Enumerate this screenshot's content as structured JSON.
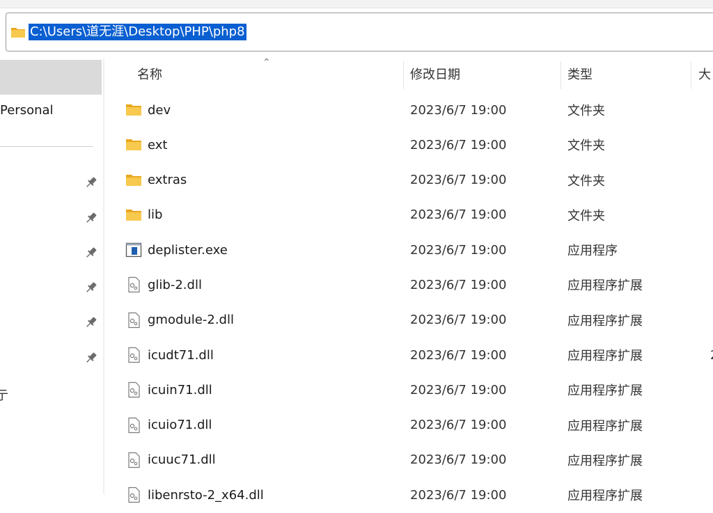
{
  "address": {
    "path": "C:\\Users\\道无涯\\Desktop\\PHP\\php8"
  },
  "nav": {
    "label": "Personal",
    "glyph": "亍",
    "pins": [
      "pin-icon",
      "pin-icon",
      "pin-icon",
      "pin-icon",
      "pin-icon",
      "pin-icon"
    ]
  },
  "columns": {
    "name": "名称",
    "date": "修改日期",
    "type": "类型",
    "size": "大"
  },
  "files": [
    {
      "name": "dev",
      "date": "2023/6/7 19:00",
      "type": "文件夹",
      "icon": "folder-icon",
      "size": ""
    },
    {
      "name": "ext",
      "date": "2023/6/7 19:00",
      "type": "文件夹",
      "icon": "folder-icon",
      "size": ""
    },
    {
      "name": "extras",
      "date": "2023/6/7 19:00",
      "type": "文件夹",
      "icon": "folder-icon",
      "size": ""
    },
    {
      "name": "lib",
      "date": "2023/6/7 19:00",
      "type": "文件夹",
      "icon": "folder-icon",
      "size": ""
    },
    {
      "name": "deplister.exe",
      "date": "2023/6/7 19:00",
      "type": "应用程序",
      "icon": "exe-icon",
      "size": ""
    },
    {
      "name": "glib-2.dll",
      "date": "2023/6/7 19:00",
      "type": "应用程序扩展",
      "icon": "dll-icon",
      "size": ""
    },
    {
      "name": "gmodule-2.dll",
      "date": "2023/6/7 19:00",
      "type": "应用程序扩展",
      "icon": "dll-icon",
      "size": ""
    },
    {
      "name": "icudt71.dll",
      "date": "2023/6/7 19:00",
      "type": "应用程序扩展",
      "icon": "dll-icon",
      "size": "2"
    },
    {
      "name": "icuin71.dll",
      "date": "2023/6/7 19:00",
      "type": "应用程序扩展",
      "icon": "dll-icon",
      "size": ""
    },
    {
      "name": "icuio71.dll",
      "date": "2023/6/7 19:00",
      "type": "应用程序扩展",
      "icon": "dll-icon",
      "size": ""
    },
    {
      "name": "icuuc71.dll",
      "date": "2023/6/7 19:00",
      "type": "应用程序扩展",
      "icon": "dll-icon",
      "size": ""
    },
    {
      "name": "libenrsto-2_x64.dll",
      "date": "2023/6/7 19:00",
      "type": "应用程序扩展",
      "icon": "dll-icon",
      "size": ""
    }
  ],
  "colors": {
    "selection": "#0a5fd1",
    "folder": "#f5c04a",
    "nav_selected": "#dadada"
  }
}
